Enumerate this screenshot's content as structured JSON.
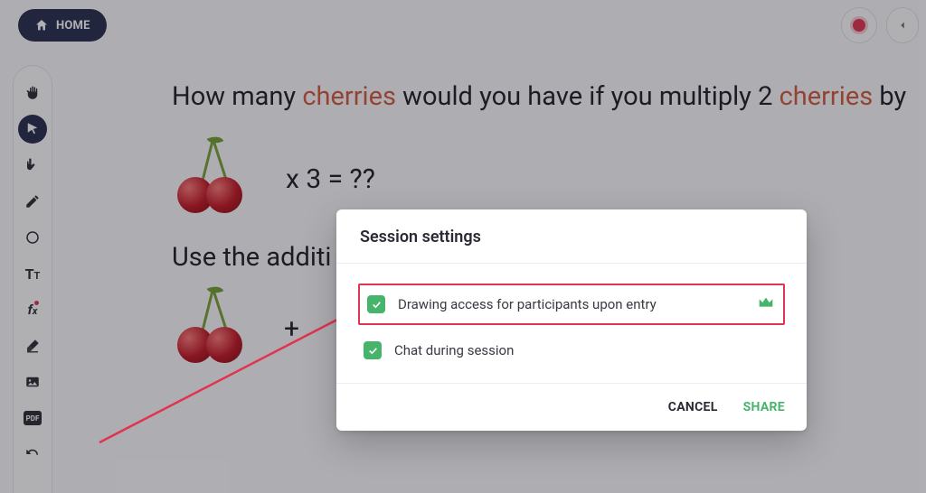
{
  "header": {
    "home_label": "HOME"
  },
  "question": {
    "part1": "How many ",
    "red1": "cherries",
    "part2": "  would you have if you multiply 2 ",
    "red2": "cherries",
    "part3": "   by"
  },
  "equation": "x 3 = ??",
  "subline": "Use the additi",
  "plus": "+",
  "modal": {
    "title": "Session settings",
    "option1": "Drawing access for participants upon entry",
    "option2": "Chat during session",
    "cancel": "CANCEL",
    "share": "SHARE"
  }
}
